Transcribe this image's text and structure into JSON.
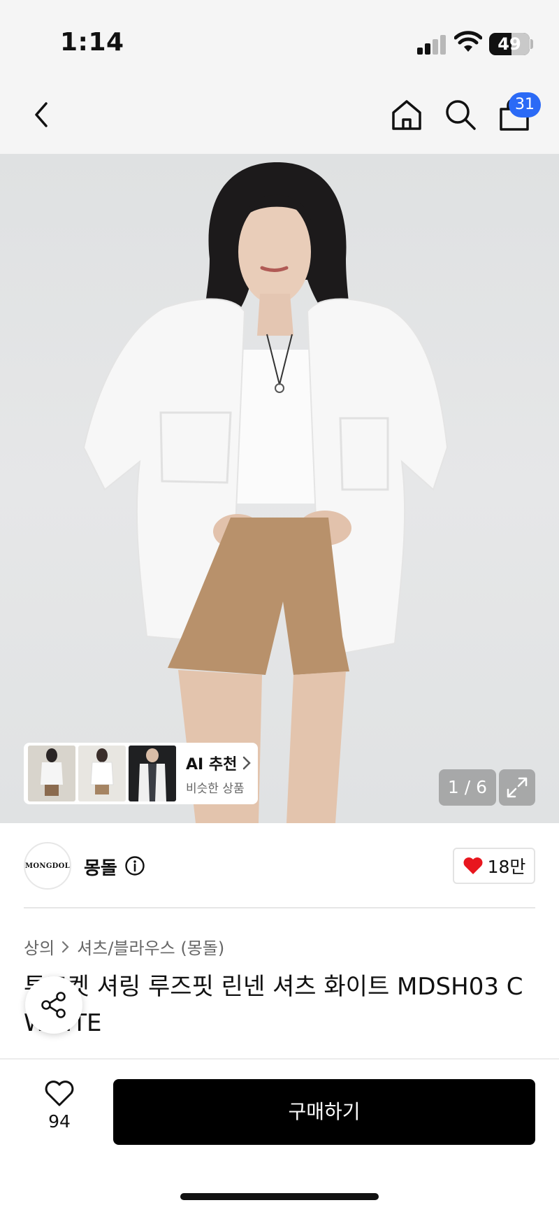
{
  "status_bar": {
    "time": "1:14",
    "battery": "49"
  },
  "header": {
    "back_icon": "chevron-left-icon",
    "home_icon": "home-icon",
    "search_icon": "search-icon",
    "cart_icon": "shopping-bag-icon",
    "cart_count": "31",
    "badge_color": "#2b6af6"
  },
  "gallery": {
    "ai_title": "AI 추천",
    "ai_subtitle": "비슷한 상품",
    "counter": "1 / 6",
    "expand_icon": "expand-icon"
  },
  "brand": {
    "logo_text": "MONGDOL",
    "name": "몽돌",
    "info_icon": "info-icon",
    "likes": "18만",
    "heart_color": "#e8161e"
  },
  "breadcrumb": {
    "category": "상의",
    "subcategory": "셔츠/블라우스 (몽돌)"
  },
  "product": {
    "title": "투포켓 셔링 루즈핏 린넨 셔츠 화이트 MDSH03 C WHITE"
  },
  "bottom": {
    "wish_count": "94",
    "buy_label": "구매하기"
  }
}
